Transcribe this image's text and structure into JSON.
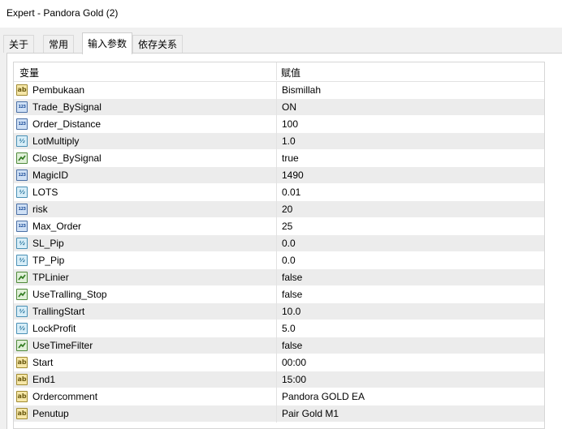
{
  "window": {
    "title": "Expert - Pandora Gold (2)"
  },
  "tabs": [
    {
      "label": "关于"
    },
    {
      "label": "常用"
    },
    {
      "label": "输入参数"
    },
    {
      "label": "依存关系"
    }
  ],
  "grid": {
    "columns": {
      "variable": "变量",
      "value": "赋值"
    },
    "rows": [
      {
        "name": "Pembukaan",
        "value": "Bismillah",
        "icon": "string-icon"
      },
      {
        "name": "Trade_BySignal",
        "value": "ON",
        "icon": "integer-icon"
      },
      {
        "name": "Order_Distance",
        "value": "100",
        "icon": "integer-icon"
      },
      {
        "name": "LotMultiply",
        "value": "1.0",
        "icon": "double-icon"
      },
      {
        "name": "Close_BySignal",
        "value": "true",
        "icon": "bool-icon"
      },
      {
        "name": "MagicID",
        "value": "1490",
        "icon": "integer-icon"
      },
      {
        "name": "LOTS",
        "value": "0.01",
        "icon": "double-icon"
      },
      {
        "name": "risk",
        "value": "20",
        "icon": "integer-icon"
      },
      {
        "name": "Max_Order",
        "value": "25",
        "icon": "integer-icon"
      },
      {
        "name": "SL_Pip",
        "value": "0.0",
        "icon": "double-icon"
      },
      {
        "name": "TP_Pip",
        "value": "0.0",
        "icon": "double-icon"
      },
      {
        "name": "TPLinier",
        "value": "false",
        "icon": "bool-icon"
      },
      {
        "name": "UseTralling_Stop",
        "value": "false",
        "icon": "bool-icon"
      },
      {
        "name": "TrallingStart",
        "value": "10.0",
        "icon": "double-icon"
      },
      {
        "name": "LockProfit",
        "value": "5.0",
        "icon": "double-icon"
      },
      {
        "name": "UseTimeFilter",
        "value": "false",
        "icon": "bool-icon"
      },
      {
        "name": "Start",
        "value": "00:00",
        "icon": "string-icon"
      },
      {
        "name": "End1",
        "value": "15:00",
        "icon": "string-icon"
      },
      {
        "name": "Ordercomment",
        "value": "Pandora GOLD EA",
        "icon": "string-icon"
      },
      {
        "name": "Penutup",
        "value": "Pair Gold M1",
        "icon": "string-icon"
      }
    ]
  }
}
